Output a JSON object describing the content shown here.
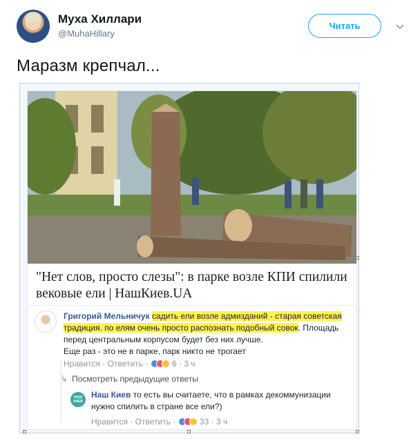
{
  "header": {
    "name": "Муха Хиллари",
    "handle": "@MuhaHillary",
    "follow_label": "Читать"
  },
  "tweet": {
    "text": "Маразм крепчал..."
  },
  "card": {
    "link_title": "\"Нет слов, просто слезы\": в парке возле КПИ спилили вековые ели | НашКиев.UA",
    "comment": {
      "author": "Григорий Мельничук",
      "highlight_1": "садить ели возле адмизданий - старая советская традиция. по елям очень просто распознать подобный совок",
      "rest_1": ". Площадь перед центральным корпусом будет без них лучше.",
      "rest_2": "Еще раз - это не в парке, парк никто не трогает",
      "like_label": "Нравится",
      "reply_label": "Ответить",
      "reactions_count": "6",
      "time": "3 ч"
    },
    "previous_replies_label": "Посмотреть предыдущие ответы",
    "reply": {
      "author": "Наш Киев",
      "avatar_text": "НАШ КИЕВ",
      "text": "то есть вы считаете, что в рамках декоммунизации нужно спилить в стране все ели?)",
      "like_label": "Нравится",
      "reply_label": "Ответить",
      "reactions_count": "33",
      "time": "3 ч"
    }
  },
  "colors": {
    "accent": "#1da1f2",
    "fb_link": "#365899",
    "highlight": "#fff34d"
  }
}
